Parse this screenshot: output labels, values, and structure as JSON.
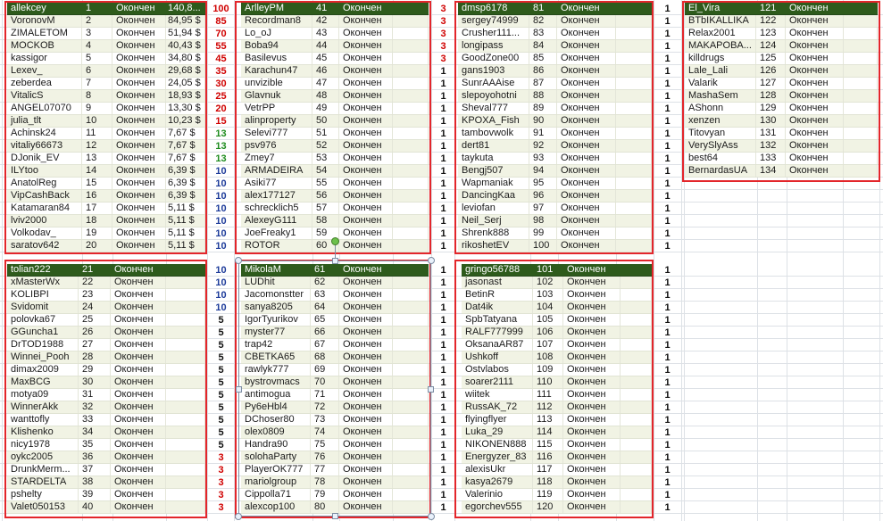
{
  "colors": {
    "header_bg": "#2e5b1c",
    "header_text": "#ffffff",
    "row_bg": "#ffffff",
    "row_band": "#f1f3e4",
    "frame_red": "#e3262b",
    "gridline": "#dde1e6",
    "selection": "#7d8da3",
    "rotate_handle": "#6cc04a"
  },
  "point_colors": {
    "100": "#d00000",
    "85": "#d00000",
    "70": "#d00000",
    "55": "#d00000",
    "45": "#d00000",
    "35": "#d00000",
    "30": "#d00000",
    "25": "#d00000",
    "20": "#d00000",
    "15": "#d00000",
    "13": "#1e8c1e",
    "10": "#1d3b9a",
    "5": "#111111",
    "3": "#d00000",
    "1": "#111111"
  },
  "tables": [
    {
      "rows": [
        {
          "name": "allekcey",
          "place": "1",
          "status": "Окончен",
          "prize": "140,8..."
        },
        {
          "name": "VoronovM",
          "place": "2",
          "status": "Окончен",
          "prize": "84,95 $"
        },
        {
          "name": "ZIMALETOM",
          "place": "3",
          "status": "Окончен",
          "prize": "51,94 $"
        },
        {
          "name": "MOCKOB",
          "place": "4",
          "status": "Окончен",
          "prize": "40,43 $"
        },
        {
          "name": "kassigor",
          "place": "5",
          "status": "Окончен",
          "prize": "34,80 $"
        },
        {
          "name": "Lexev_",
          "place": "6",
          "status": "Окончен",
          "prize": "29,68 $"
        },
        {
          "name": "zeberdea",
          "place": "7",
          "status": "Окончен",
          "prize": "24,05 $"
        },
        {
          "name": "VitalicS",
          "place": "8",
          "status": "Окончен",
          "prize": "18,93 $"
        },
        {
          "name": "ANGEL07070",
          "place": "9",
          "status": "Окончен",
          "prize": "13,30 $"
        },
        {
          "name": "julia_tlt",
          "place": "10",
          "status": "Окончен",
          "prize": "10,23 $"
        },
        {
          "name": "Achinsk24",
          "place": "11",
          "status": "Окончен",
          "prize": "7,67 $"
        },
        {
          "name": "vitaliy66673",
          "place": "12",
          "status": "Окончен",
          "prize": "7,67 $"
        },
        {
          "name": "DJonik_EV",
          "place": "13",
          "status": "Окончен",
          "prize": "7,67 $"
        },
        {
          "name": "ILYtoo",
          "place": "14",
          "status": "Окончен",
          "prize": "6,39 $"
        },
        {
          "name": "AnatolReg",
          "place": "15",
          "status": "Окончен",
          "prize": "6,39 $"
        },
        {
          "name": "VipCashBack",
          "place": "16",
          "status": "Окончен",
          "prize": "6,39 $"
        },
        {
          "name": "Katamaran84",
          "place": "17",
          "status": "Окончен",
          "prize": "5,11 $"
        },
        {
          "name": "lviv2000",
          "place": "18",
          "status": "Окончен",
          "prize": "5,11 $"
        },
        {
          "name": "Volkodav_",
          "place": "19",
          "status": "Окончен",
          "prize": "5,11 $"
        },
        {
          "name": "saratov642",
          "place": "20",
          "status": "Окончен",
          "prize": "5,11 $"
        }
      ]
    },
    {
      "rows": [
        {
          "name": "ArlleyPM",
          "place": "41",
          "status": "Окончен"
        },
        {
          "name": "Recordman8",
          "place": "42",
          "status": "Окончен"
        },
        {
          "name": "Lo_oJ",
          "place": "43",
          "status": "Окончен"
        },
        {
          "name": "Boba94",
          "place": "44",
          "status": "Окончен"
        },
        {
          "name": "Basilevus",
          "place": "45",
          "status": "Окончен"
        },
        {
          "name": "Karachun47",
          "place": "46",
          "status": "Окончен"
        },
        {
          "name": "unvizible",
          "place": "47",
          "status": "Окончен"
        },
        {
          "name": "Glavnuk",
          "place": "48",
          "status": "Окончен"
        },
        {
          "name": "VetrPP",
          "place": "49",
          "status": "Окончен"
        },
        {
          "name": "alinproperty",
          "place": "50",
          "status": "Окончен"
        },
        {
          "name": "Selevi777",
          "place": "51",
          "status": "Окончен"
        },
        {
          "name": "psv976",
          "place": "52",
          "status": "Окончен"
        },
        {
          "name": "Zmey7",
          "place": "53",
          "status": "Окончен"
        },
        {
          "name": "ARMADEIRA",
          "place": "54",
          "status": "Окончен"
        },
        {
          "name": "Asiki77",
          "place": "55",
          "status": "Окончен"
        },
        {
          "name": "alex177127",
          "place": "56",
          "status": "Окончен"
        },
        {
          "name": "schrecklich5",
          "place": "57",
          "status": "Окончен"
        },
        {
          "name": "AlexeyG111",
          "place": "58",
          "status": "Окончен"
        },
        {
          "name": "JoeFreaky1",
          "place": "59",
          "status": "Окончен"
        },
        {
          "name": "ROTOR",
          "place": "60",
          "status": "Окончен"
        }
      ]
    },
    {
      "rows": [
        {
          "name": "dmsp6178",
          "place": "81",
          "status": "Окончен"
        },
        {
          "name": "sergey74999",
          "place": "82",
          "status": "Окончен"
        },
        {
          "name": "Crusher111...",
          "place": "83",
          "status": "Окончен"
        },
        {
          "name": "longipass",
          "place": "84",
          "status": "Окончен"
        },
        {
          "name": "GoodZone00",
          "place": "85",
          "status": "Окончен"
        },
        {
          "name": "gans1903",
          "place": "86",
          "status": "Окончен"
        },
        {
          "name": "SunrAAAise",
          "place": "87",
          "status": "Окончен"
        },
        {
          "name": "slepoyohotni",
          "place": "88",
          "status": "Окончен"
        },
        {
          "name": "Sheval777",
          "place": "89",
          "status": "Окончен"
        },
        {
          "name": "KPOXA_Fish",
          "place": "90",
          "status": "Окончен"
        },
        {
          "name": "tambovwolk",
          "place": "91",
          "status": "Окончен"
        },
        {
          "name": "dert81",
          "place": "92",
          "status": "Окончен"
        },
        {
          "name": "taykuta",
          "place": "93",
          "status": "Окончен"
        },
        {
          "name": "Bengj507",
          "place": "94",
          "status": "Окончен"
        },
        {
          "name": "Wapmaniak",
          "place": "95",
          "status": "Окончен"
        },
        {
          "name": "DancingKaa",
          "place": "96",
          "status": "Окончен"
        },
        {
          "name": "leviofan",
          "place": "97",
          "status": "Окончен"
        },
        {
          "name": "Neil_Serj",
          "place": "98",
          "status": "Окончен"
        },
        {
          "name": "Shrenk888",
          "place": "99",
          "status": "Окончен"
        },
        {
          "name": "rikoshetEV",
          "place": "100",
          "status": "Окончен"
        }
      ]
    },
    {
      "rows": [
        {
          "name": "El_Vira",
          "place": "121",
          "status": "Окончен"
        },
        {
          "name": "BTbIKALLIKA",
          "place": "122",
          "status": "Окончен"
        },
        {
          "name": "Relax2001",
          "place": "123",
          "status": "Окончен"
        },
        {
          "name": "MAKAPOBA...",
          "place": "124",
          "status": "Окончен"
        },
        {
          "name": "killdrugs",
          "place": "125",
          "status": "Окончен"
        },
        {
          "name": "Lale_Lali",
          "place": "126",
          "status": "Окончен"
        },
        {
          "name": "Valarik",
          "place": "127",
          "status": "Окончен"
        },
        {
          "name": "MashaSem",
          "place": "128",
          "status": "Окончен"
        },
        {
          "name": "AShonn",
          "place": "129",
          "status": "Окончен"
        },
        {
          "name": "xenzen",
          "place": "130",
          "status": "Окончен"
        },
        {
          "name": "Titovyan",
          "place": "131",
          "status": "Окончен"
        },
        {
          "name": "VerySlyAss",
          "place": "132",
          "status": "Окончен"
        },
        {
          "name": "best64",
          "place": "133",
          "status": "Окончен"
        },
        {
          "name": "BernardasUA",
          "place": "134",
          "status": "Окончен"
        }
      ]
    },
    {
      "rows": [
        {
          "name": "tolian222",
          "place": "21",
          "status": "Окончен"
        },
        {
          "name": "xMasterWx",
          "place": "22",
          "status": "Окончен"
        },
        {
          "name": "KOLIBPI",
          "place": "23",
          "status": "Окончен"
        },
        {
          "name": "Svidomit",
          "place": "24",
          "status": "Окончен"
        },
        {
          "name": "polovka67",
          "place": "25",
          "status": "Окончен"
        },
        {
          "name": "GGuncha1",
          "place": "26",
          "status": "Окончен"
        },
        {
          "name": "DrTOD1988",
          "place": "27",
          "status": "Окончен"
        },
        {
          "name": "Winnei_Pooh",
          "place": "28",
          "status": "Окончен"
        },
        {
          "name": "dimax2009",
          "place": "29",
          "status": "Окончен"
        },
        {
          "name": "MaxBCG",
          "place": "30",
          "status": "Окончен"
        },
        {
          "name": "motya09",
          "place": "31",
          "status": "Окончен"
        },
        {
          "name": "WinnerAkk",
          "place": "32",
          "status": "Окончен"
        },
        {
          "name": "wanttofly",
          "place": "33",
          "status": "Окончен"
        },
        {
          "name": "Klishenko",
          "place": "34",
          "status": "Окончен"
        },
        {
          "name": "nicy1978",
          "place": "35",
          "status": "Окончен"
        },
        {
          "name": "oykc2005",
          "place": "36",
          "status": "Окончен"
        },
        {
          "name": "DrunkMerm...",
          "place": "37",
          "status": "Окончен"
        },
        {
          "name": "STARDELTA",
          "place": "38",
          "status": "Окончен"
        },
        {
          "name": "pshelty",
          "place": "39",
          "status": "Окончен"
        },
        {
          "name": "Valet050153",
          "place": "40",
          "status": "Окончен"
        }
      ]
    },
    {
      "rows": [
        {
          "name": "MikolaM",
          "place": "61",
          "status": "Окончен"
        },
        {
          "name": "LUDhit",
          "place": "62",
          "status": "Окончен"
        },
        {
          "name": "Jacomonstter",
          "place": "63",
          "status": "Окончен"
        },
        {
          "name": "sanya8205",
          "place": "64",
          "status": "Окончен"
        },
        {
          "name": "IgorTyurikov",
          "place": "65",
          "status": "Окончен"
        },
        {
          "name": "myster77",
          "place": "66",
          "status": "Окончен"
        },
        {
          "name": "trap42",
          "place": "67",
          "status": "Окончен"
        },
        {
          "name": "CBETKA65",
          "place": "68",
          "status": "Окончен"
        },
        {
          "name": "rawlyk777",
          "place": "69",
          "status": "Окончен"
        },
        {
          "name": "bystrovmacs",
          "place": "70",
          "status": "Окончен"
        },
        {
          "name": "antimogua",
          "place": "71",
          "status": "Окончен"
        },
        {
          "name": "Py6eHbl4",
          "place": "72",
          "status": "Окончен"
        },
        {
          "name": "DChoser80",
          "place": "73",
          "status": "Окончен"
        },
        {
          "name": "olex0809",
          "place": "74",
          "status": "Окончен"
        },
        {
          "name": "Handra90",
          "place": "75",
          "status": "Окончен"
        },
        {
          "name": "solohaParty",
          "place": "76",
          "status": "Окончен"
        },
        {
          "name": "PlayerOK777",
          "place": "77",
          "status": "Окончен"
        },
        {
          "name": "mariolgroup",
          "place": "78",
          "status": "Окончен"
        },
        {
          "name": "Cippolla71",
          "place": "79",
          "status": "Окончен"
        },
        {
          "name": "alexcop100",
          "place": "80",
          "status": "Окончен"
        }
      ]
    },
    {
      "rows": [
        {
          "name": "gringo56788",
          "place": "101",
          "status": "Окончен"
        },
        {
          "name": "jasonast",
          "place": "102",
          "status": "Окончен"
        },
        {
          "name": "BetinR",
          "place": "103",
          "status": "Окончен"
        },
        {
          "name": "Dat4ik",
          "place": "104",
          "status": "Окончен"
        },
        {
          "name": "SpbTatyana",
          "place": "105",
          "status": "Окончен"
        },
        {
          "name": "RALF777999",
          "place": "106",
          "status": "Окончен"
        },
        {
          "name": "OksanaAR87",
          "place": "107",
          "status": "Окончен"
        },
        {
          "name": "Ushkoff",
          "place": "108",
          "status": "Окончен"
        },
        {
          "name": "Ostvlabos",
          "place": "109",
          "status": "Окончен"
        },
        {
          "name": "soarer2111",
          "place": "110",
          "status": "Окончен"
        },
        {
          "name": "wiitek",
          "place": "111",
          "status": "Окончен"
        },
        {
          "name": "RussAK_72",
          "place": "112",
          "status": "Окончен"
        },
        {
          "name": "flyingflyer",
          "place": "113",
          "status": "Окончен"
        },
        {
          "name": "Luka_29",
          "place": "114",
          "status": "Окончен"
        },
        {
          "name": "NIKONEN888",
          "place": "115",
          "status": "Окончен"
        },
        {
          "name": "Energyzer_83",
          "place": "116",
          "status": "Окончен"
        },
        {
          "name": "alexisUkr",
          "place": "117",
          "status": "Окончен"
        },
        {
          "name": "kasya2679",
          "place": "118",
          "status": "Окончен"
        },
        {
          "name": "Valerinio",
          "place": "119",
          "status": "Окончен"
        },
        {
          "name": "egorchev555",
          "place": "120",
          "status": "Окончен"
        }
      ]
    }
  ],
  "points": [
    [
      "100",
      "85",
      "70",
      "55",
      "45",
      "35",
      "30",
      "25",
      "20",
      "15",
      "13",
      "13",
      "13",
      "10",
      "10",
      "10",
      "10",
      "10",
      "10",
      "10"
    ],
    [
      "10",
      "10",
      "10",
      "10",
      "5",
      "5",
      "5",
      "5",
      "5",
      "5",
      "5",
      "5",
      "5",
      "5",
      "5",
      "3",
      "3",
      "3",
      "3",
      "3"
    ],
    [
      "3",
      "3",
      "3",
      "3",
      "3",
      "1",
      "1",
      "1",
      "1",
      "1",
      "1",
      "1",
      "1",
      "1",
      "1",
      "1",
      "1",
      "1",
      "1",
      "1"
    ],
    [
      "1",
      "1",
      "1",
      "1",
      "1",
      "1",
      "1",
      "1",
      "1",
      "1",
      "1",
      "1",
      "1",
      "1",
      "1",
      "1",
      "1",
      "1",
      "1",
      "1"
    ],
    [
      "1",
      "1",
      "1",
      "1",
      "1",
      "1",
      "1",
      "1",
      "1",
      "1",
      "1",
      "1",
      "1",
      "1",
      "1",
      "1",
      "1",
      "1",
      "1",
      "1"
    ],
    [
      "1",
      "1",
      "1",
      "1",
      "1",
      "1",
      "1",
      "1",
      "1",
      "1",
      "1",
      "1",
      "1",
      "1",
      "1",
      "1",
      "1",
      "1",
      "1",
      "1"
    ]
  ]
}
